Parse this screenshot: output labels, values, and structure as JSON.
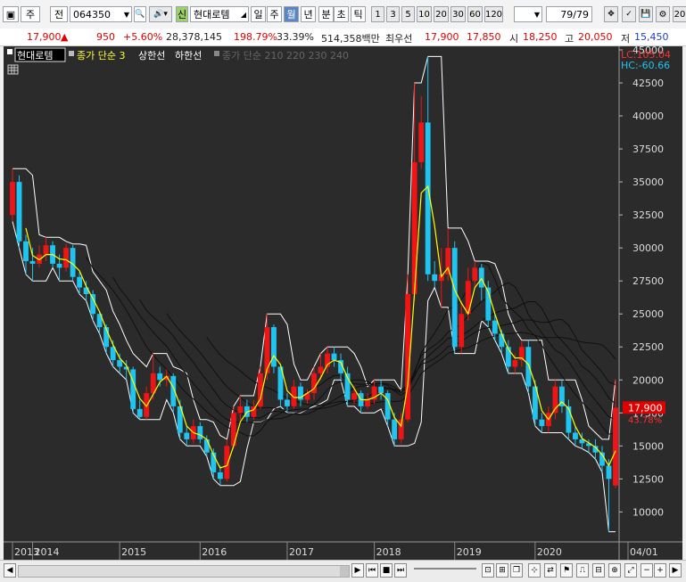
{
  "toolbar": {
    "period_label": "주",
    "prev_label": "전",
    "code_value": "064350",
    "market_badge": "신",
    "stock_name": "현대로템",
    "period_tabs": [
      "일",
      "주",
      "월",
      "년",
      "분",
      "초",
      "틱"
    ],
    "active_tab": "월",
    "n_buttons": [
      "1",
      "3",
      "5",
      "10",
      "20",
      "30",
      "60",
      "120"
    ],
    "page_counter": "79",
    "page_total": "/79",
    "right_cut": "20"
  },
  "quote": {
    "price": "17,900",
    "change": "950",
    "change_pct": "+5.60%",
    "volume": "28,378,145",
    "volume_ratio": "198.79%",
    "turnover": "33.39%",
    "amount": "514,358백만",
    "best_label": "최우선",
    "best_ask": "17,900",
    "best_bid": "17,850",
    "open_label": "시",
    "open": "18,250",
    "high_label": "고",
    "high": "20,050",
    "low_label": "저",
    "low": "15,450"
  },
  "legend": {
    "name": "현대로템",
    "ma": "종가 단순 3",
    "upper": "상한선",
    "lower": "하한선",
    "long_ma": "종가 단순 210 220 230 240"
  },
  "price_scale": {
    "lc": "LC:105.04",
    "hc": "HC:-60.66",
    "current": "17,900",
    "current_pct": "43.78%"
  },
  "time_axis": {
    "x_labels": [
      "2013",
      "2014",
      "2015",
      "2016",
      "2017",
      "2018",
      "2019",
      "2020",
      "04/01"
    ]
  },
  "colors": {
    "up": "#f01414",
    "down": "#1fc4f0",
    "ma": "#ffff00",
    "band": "#ffffff",
    "long_ma": "#101010",
    "background": "#2b2b2b"
  },
  "chart_data": {
    "type": "candlestick",
    "title": "현대로템",
    "ylim": [
      8000,
      45000
    ],
    "yticks": [
      10000,
      12500,
      15000,
      17500,
      20000,
      22500,
      25000,
      27500,
      30000,
      32500,
      35000,
      37500,
      40000,
      42500,
      45000
    ],
    "candles": [
      {
        "o": 32500,
        "c": 35000,
        "h": 36000,
        "l": 32000
      },
      {
        "o": 35000,
        "c": 30500,
        "h": 35500,
        "l": 30000
      },
      {
        "o": 30500,
        "c": 29000,
        "h": 31000,
        "l": 28000
      },
      {
        "o": 29000,
        "c": 28800,
        "h": 30000,
        "l": 27500
      },
      {
        "o": 28800,
        "c": 29500,
        "h": 30200,
        "l": 28500
      },
      {
        "o": 29500,
        "c": 30200,
        "h": 30800,
        "l": 29000
      },
      {
        "o": 30200,
        "c": 28800,
        "h": 30500,
        "l": 28500
      },
      {
        "o": 28800,
        "c": 28500,
        "h": 29500,
        "l": 27500
      },
      {
        "o": 28500,
        "c": 30000,
        "h": 30300,
        "l": 28200
      },
      {
        "o": 30000,
        "c": 27800,
        "h": 30200,
        "l": 27500
      },
      {
        "o": 27800,
        "c": 27000,
        "h": 28200,
        "l": 26500
      },
      {
        "o": 27000,
        "c": 26500,
        "h": 27500,
        "l": 26000
      },
      {
        "o": 26500,
        "c": 25000,
        "h": 26800,
        "l": 24500
      },
      {
        "o": 25000,
        "c": 24000,
        "h": 25200,
        "l": 23500
      },
      {
        "o": 24000,
        "c": 22500,
        "h": 24200,
        "l": 22000
      },
      {
        "o": 22500,
        "c": 21500,
        "h": 23000,
        "l": 21000
      },
      {
        "o": 21500,
        "c": 21000,
        "h": 22000,
        "l": 20500
      },
      {
        "o": 21000,
        "c": 20800,
        "h": 21500,
        "l": 20000
      },
      {
        "o": 20800,
        "c": 17800,
        "h": 21000,
        "l": 17500
      },
      {
        "o": 17800,
        "c": 17200,
        "h": 18500,
        "l": 17000
      },
      {
        "o": 17200,
        "c": 19000,
        "h": 19500,
        "l": 17000
      },
      {
        "o": 19000,
        "c": 20500,
        "h": 22000,
        "l": 18500
      },
      {
        "o": 20500,
        "c": 20000,
        "h": 21000,
        "l": 19500
      },
      {
        "o": 20000,
        "c": 20300,
        "h": 20800,
        "l": 19500
      },
      {
        "o": 20300,
        "c": 18000,
        "h": 20500,
        "l": 17500
      },
      {
        "o": 18000,
        "c": 16000,
        "h": 18500,
        "l": 15500
      },
      {
        "o": 16000,
        "c": 15500,
        "h": 16500,
        "l": 15000
      },
      {
        "o": 15500,
        "c": 16500,
        "h": 17000,
        "l": 15200
      },
      {
        "o": 16500,
        "c": 15500,
        "h": 16800,
        "l": 15200
      },
      {
        "o": 15500,
        "c": 14500,
        "h": 15800,
        "l": 14200
      },
      {
        "o": 14500,
        "c": 13000,
        "h": 14800,
        "l": 12500
      },
      {
        "o": 13000,
        "c": 12500,
        "h": 13500,
        "l": 12000
      },
      {
        "o": 12500,
        "c": 15000,
        "h": 15500,
        "l": 12300
      },
      {
        "o": 15000,
        "c": 17500,
        "h": 18000,
        "l": 14800
      },
      {
        "o": 17500,
        "c": 18000,
        "h": 18800,
        "l": 17000
      },
      {
        "o": 18000,
        "c": 17200,
        "h": 18500,
        "l": 16800
      },
      {
        "o": 17200,
        "c": 18000,
        "h": 18500,
        "l": 17000
      },
      {
        "o": 18000,
        "c": 20500,
        "h": 21000,
        "l": 17800
      },
      {
        "o": 20500,
        "c": 24000,
        "h": 25000,
        "l": 20000
      },
      {
        "o": 24000,
        "c": 21000,
        "h": 24200,
        "l": 20500
      },
      {
        "o": 21000,
        "c": 18500,
        "h": 21200,
        "l": 18000
      },
      {
        "o": 18500,
        "c": 18000,
        "h": 19000,
        "l": 17500
      },
      {
        "o": 18000,
        "c": 19500,
        "h": 20000,
        "l": 17800
      },
      {
        "o": 19500,
        "c": 18500,
        "h": 19800,
        "l": 18000
      },
      {
        "o": 18500,
        "c": 19000,
        "h": 19300,
        "l": 18200
      },
      {
        "o": 19000,
        "c": 20500,
        "h": 21000,
        "l": 18500
      },
      {
        "o": 20500,
        "c": 21000,
        "h": 22000,
        "l": 20000
      },
      {
        "o": 21000,
        "c": 22000,
        "h": 22500,
        "l": 20500
      },
      {
        "o": 22000,
        "c": 21500,
        "h": 22500,
        "l": 21000
      },
      {
        "o": 21500,
        "c": 20500,
        "h": 22000,
        "l": 20000
      },
      {
        "o": 20500,
        "c": 18500,
        "h": 21000,
        "l": 18000
      },
      {
        "o": 18500,
        "c": 19000,
        "h": 19500,
        "l": 18200
      },
      {
        "o": 19000,
        "c": 18000,
        "h": 19200,
        "l": 17500
      },
      {
        "o": 18000,
        "c": 18500,
        "h": 19000,
        "l": 17800
      },
      {
        "o": 18500,
        "c": 19500,
        "h": 20000,
        "l": 18200
      },
      {
        "o": 19500,
        "c": 19000,
        "h": 20000,
        "l": 18500
      },
      {
        "o": 19000,
        "c": 17000,
        "h": 19200,
        "l": 16500
      },
      {
        "o": 17000,
        "c": 15500,
        "h": 17500,
        "l": 15000
      },
      {
        "o": 15500,
        "c": 17000,
        "h": 17500,
        "l": 15200
      },
      {
        "o": 17000,
        "c": 26500,
        "h": 28000,
        "l": 16800
      },
      {
        "o": 26500,
        "c": 36500,
        "h": 42500,
        "l": 26000
      },
      {
        "o": 36500,
        "c": 39500,
        "h": 41500,
        "l": 36000
      },
      {
        "o": 39500,
        "c": 28000,
        "h": 44500,
        "l": 27500
      },
      {
        "o": 28000,
        "c": 27500,
        "h": 29000,
        "l": 27000
      },
      {
        "o": 27500,
        "c": 28000,
        "h": 30000,
        "l": 25500
      },
      {
        "o": 28000,
        "c": 30000,
        "h": 31500,
        "l": 27500
      },
      {
        "o": 30000,
        "c": 22500,
        "h": 30500,
        "l": 22000
      },
      {
        "o": 22500,
        "c": 25000,
        "h": 26000,
        "l": 22000
      },
      {
        "o": 25000,
        "c": 27500,
        "h": 28500,
        "l": 24500
      },
      {
        "o": 27500,
        "c": 28500,
        "h": 29000,
        "l": 27000
      },
      {
        "o": 28500,
        "c": 27000,
        "h": 28800,
        "l": 26000
      },
      {
        "o": 27000,
        "c": 24500,
        "h": 27500,
        "l": 24000
      },
      {
        "o": 24500,
        "c": 23500,
        "h": 25000,
        "l": 23000
      },
      {
        "o": 23500,
        "c": 22500,
        "h": 23800,
        "l": 22000
      },
      {
        "o": 22500,
        "c": 21000,
        "h": 23000,
        "l": 20500
      },
      {
        "o": 21000,
        "c": 21500,
        "h": 22000,
        "l": 20500
      },
      {
        "o": 21500,
        "c": 22500,
        "h": 23000,
        "l": 21000
      },
      {
        "o": 22500,
        "c": 19500,
        "h": 23000,
        "l": 19000
      },
      {
        "o": 19500,
        "c": 17000,
        "h": 20000,
        "l": 16500
      },
      {
        "o": 17000,
        "c": 16500,
        "h": 17500,
        "l": 16000
      },
      {
        "o": 16500,
        "c": 17500,
        "h": 18000,
        "l": 16000
      },
      {
        "o": 17500,
        "c": 19500,
        "h": 20000,
        "l": 17000
      },
      {
        "o": 19500,
        "c": 18000,
        "h": 20000,
        "l": 17500
      },
      {
        "o": 18000,
        "c": 16000,
        "h": 18500,
        "l": 15500
      },
      {
        "o": 16000,
        "c": 15500,
        "h": 16500,
        "l": 15000
      },
      {
        "o": 15500,
        "c": 15200,
        "h": 16000,
        "l": 14800
      },
      {
        "o": 15200,
        "c": 15000,
        "h": 15500,
        "l": 14500
      },
      {
        "o": 15000,
        "c": 14500,
        "h": 15500,
        "l": 14000
      },
      {
        "o": 14500,
        "c": 13500,
        "h": 15000,
        "l": 13000
      },
      {
        "o": 13500,
        "c": 12500,
        "h": 14000,
        "l": 8500
      },
      {
        "o": 12000,
        "c": 17900,
        "h": 20050,
        "l": 11800
      }
    ]
  }
}
